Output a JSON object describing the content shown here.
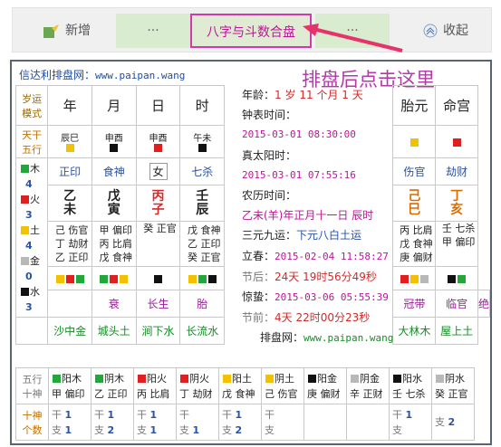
{
  "toolbar": {
    "add": "新增",
    "dots1": "···",
    "main": "八字与斗数合盘",
    "dots2": "···",
    "fold": "收起"
  },
  "site": {
    "label": "信达利排盘网：",
    "url": "www.paipan.wang"
  },
  "note": "排盘后点击这里",
  "headers": {
    "dayun": "岁运\n模式",
    "cols": [
      "年",
      "月",
      "日",
      "时"
    ],
    "tai": "胎元",
    "ming": "命宫"
  },
  "tiangan_label": "天干\n五行",
  "branch_top": [
    "辰巳",
    "申酉",
    "申酉",
    "午未"
  ],
  "wx_counts": [
    {
      "name": "木",
      "n": "4",
      "color": "#22a83a"
    },
    {
      "name": "火",
      "n": "3",
      "color": "#e02020"
    },
    {
      "name": "土",
      "n": "4",
      "color": "#f2c200"
    },
    {
      "name": "金",
      "n": "0",
      "color": "#b8b8b8"
    },
    {
      "name": "水",
      "n": "3",
      "color": "#111111"
    }
  ],
  "shishen": [
    "正印",
    "食神",
    "女",
    "七杀"
  ],
  "tai_shishen": "伤官",
  "ming_shishen": "劫财",
  "ganzhi": [
    [
      "乙",
      "未"
    ],
    [
      "戊",
      "寅"
    ],
    [
      "丙",
      "子"
    ],
    [
      "壬",
      "辰"
    ]
  ],
  "tai_gz": [
    "己",
    "巳"
  ],
  "ming_gz": [
    "丁",
    "亥"
  ],
  "canggan": [
    [
      "己 伤官",
      "丁 劫财",
      "乙 正印"
    ],
    [
      "甲 偏印",
      "丙 比肩",
      "戊 食神"
    ],
    [
      "癸 正官",
      "",
      ""
    ],
    [
      "戊 食神",
      "乙 正印",
      "癸 正官"
    ]
  ],
  "tai_cg": [
    "丙 比肩",
    "戊 食神",
    "庚 偏财"
  ],
  "ming_cg": [
    "壬 七杀",
    "甲 偏印",
    ""
  ],
  "changsheng": [
    "衰",
    "长生",
    "胎",
    "冠带"
  ],
  "tai_cs": "临官",
  "ming_cs": "绝",
  "nayin": [
    "沙中金",
    "城头土",
    "涧下水",
    "长流水"
  ],
  "tai_ny": "大林木",
  "ming_ny": "屋上土",
  "bottom_rows": {
    "l1": "五行\n十神",
    "l2": "十神\n个数"
  },
  "bottom": [
    {
      "sq": "#22a83a",
      "top": "阳木",
      "bot": "甲 偏印",
      "g": "干",
      "gn": "1",
      "z": "支",
      "zn": "1"
    },
    {
      "sq": "#22a83a",
      "top": "阴木",
      "bot": "乙 正印",
      "g": "干",
      "gn": "1",
      "z": "支",
      "zn": "2"
    },
    {
      "sq": "#e02020",
      "top": "阳火",
      "bot": "丙 比肩",
      "g": "干",
      "gn": "1",
      "z": "支",
      "zn": "1"
    },
    {
      "sq": "#e02020",
      "top": "阴火",
      "bot": "丁 劫财",
      "g": "干",
      "gn": "",
      "z": "支",
      "zn": "1"
    },
    {
      "sq": "#f2c200",
      "top": "阳土",
      "bot": "戊 食神",
      "g": "干",
      "gn": "1",
      "z": "支",
      "zn": "2"
    },
    {
      "sq": "#f2c200",
      "top": "阴土",
      "bot": "己 伤官",
      "g": "干",
      "gn": "",
      "z": "支",
      "zn": ""
    },
    {
      "sq": "#111111",
      "top": "阳金",
      "bot": "庚 偏财",
      "g": "",
      "gn": "",
      "z": "",
      "zn": ""
    },
    {
      "sq": "#b8b8b8",
      "top": "阴金",
      "bot": "辛 正财",
      "g": "",
      "gn": "",
      "z": "",
      "zn": ""
    },
    {
      "sq": "#111111",
      "top": "阳水",
      "bot": "壬 七杀",
      "g": "干",
      "gn": "1",
      "z": "支",
      "zn": ""
    },
    {
      "sq": "#b8b8b8",
      "top": "阴水",
      "bot": "癸 正官",
      "g": "",
      "gn": "",
      "z": "支",
      "zn": "2"
    }
  ],
  "middle": {
    "age_label": "年龄：",
    "age_y": "1",
    "age_yu": "岁",
    "age_m": "11",
    "age_mu": "个月",
    "age_d": "1",
    "age_du": "天",
    "clock_label": "钟表时间：",
    "clock": "2015-03-01 08:30:00",
    "solar_label": "真太阳时：",
    "solar": "2015-03-01 07:55:16",
    "lunar_label": "农历时间：",
    "lunar": "乙未(羊)年正月十一日 辰时",
    "yun_label": "三元九运：",
    "yun": "下元八白土运",
    "lichun_label": "立春：",
    "lichun": "2015-02-04 11:58:27",
    "jq1_label": "节后：",
    "jq1": "24天 19时56分49秒",
    "jingzhe_label": "惊蛰：",
    "jingzhe": "2015-03-06 05:55:39",
    "jq2_label": "节前：",
    "jq2": "4天 22时00分23秒",
    "site_label": "排盘网：",
    "site_url": "www.paipan.wang"
  }
}
